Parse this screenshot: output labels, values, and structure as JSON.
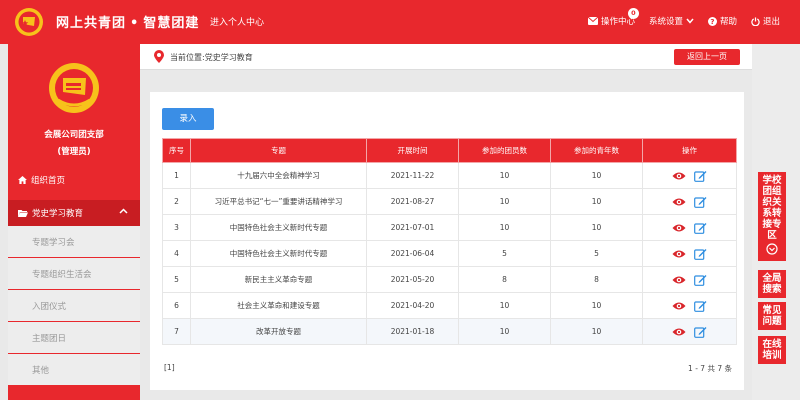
{
  "header": {
    "title_a": "网上共青团",
    "title_dot": "•",
    "title_b": "智慧团建",
    "personal_link": "进入个人中心",
    "ops_center": "操作中心",
    "ops_badge": "0",
    "settings": "系统设置",
    "help": "帮助",
    "logout": "退出"
  },
  "sidebar": {
    "org_name": "会展公司团支部",
    "org_role": "(管理员)",
    "home": "组织首页",
    "group": "党史学习教育",
    "items": [
      {
        "label": "专题学习会"
      },
      {
        "label": "专题组织生活会"
      },
      {
        "label": "入团仪式"
      },
      {
        "label": "主题团日"
      },
      {
        "label": "其他"
      }
    ]
  },
  "breadcrumb": {
    "text": "当前位置:党史学习教育",
    "back": "返回上一页"
  },
  "toolbar": {
    "add_label": "录入"
  },
  "table": {
    "headers": [
      "序号",
      "专题",
      "开展时间",
      "参加的团员数",
      "参加的青年数",
      "操作"
    ],
    "rows": [
      {
        "no": "1",
        "topic": "十九届六中全会精神学习",
        "date": "2021-11-22",
        "members": "10",
        "youth": "10"
      },
      {
        "no": "2",
        "topic": "习近平总书记“七一”重要讲话精神学习",
        "date": "2021-08-27",
        "members": "10",
        "youth": "10"
      },
      {
        "no": "3",
        "topic": "中国特色社会主义新时代专题",
        "date": "2021-07-01",
        "members": "10",
        "youth": "10"
      },
      {
        "no": "4",
        "topic": "中国特色社会主义新时代专题",
        "date": "2021-06-04",
        "members": "5",
        "youth": "5"
      },
      {
        "no": "5",
        "topic": "新民主主义革命专题",
        "date": "2021-05-20",
        "members": "8",
        "youth": "8"
      },
      {
        "no": "6",
        "topic": "社会主义革命和建设专题",
        "date": "2021-04-20",
        "members": "10",
        "youth": "10"
      },
      {
        "no": "7",
        "topic": "改革开放专题",
        "date": "2021-01-18",
        "members": "10",
        "youth": "10"
      }
    ]
  },
  "pager": {
    "pages": "[1]",
    "summary": "1 - 7  共 7 条"
  },
  "rail": {
    "school": "学校团组织关系转接专区",
    "search": "全局搜索",
    "faq": "常见问题",
    "training": "在线培训"
  },
  "colors": {
    "brand_red": "#e8282d",
    "add_blue": "#3a8ee6",
    "view_red": "#d9262b",
    "edit_blue": "#2f8ee0"
  }
}
